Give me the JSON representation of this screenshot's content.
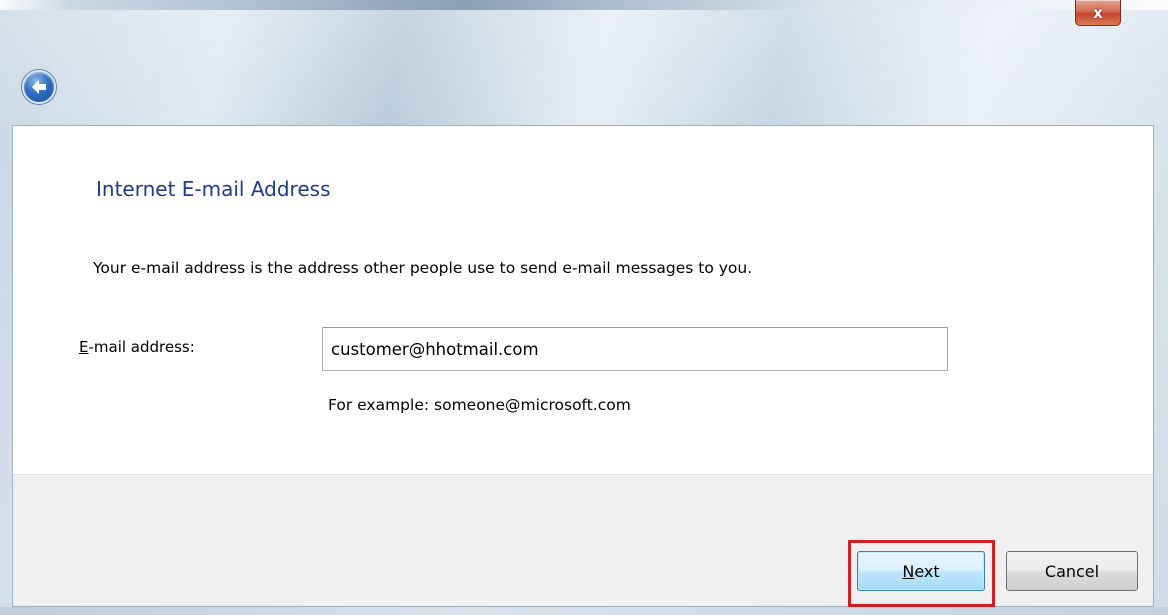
{
  "window": {
    "close_label": "x"
  },
  "nav": {
    "back_icon": "back-arrow-icon"
  },
  "page": {
    "title": "Internet E-mail Address",
    "description": "Your e-mail address is the address other people use to send e-mail messages to you."
  },
  "form": {
    "email_label_access_key": "E",
    "email_label_rest": "-mail address:",
    "email_value": "customer@hhotmail.com",
    "example": "For example: someone@microsoft.com"
  },
  "buttons": {
    "next_access_key": "N",
    "next_rest": "ext",
    "cancel": "Cancel"
  },
  "colors": {
    "title": "#1e3b8c",
    "highlight": "#d21f26",
    "close": "#c5452c"
  }
}
